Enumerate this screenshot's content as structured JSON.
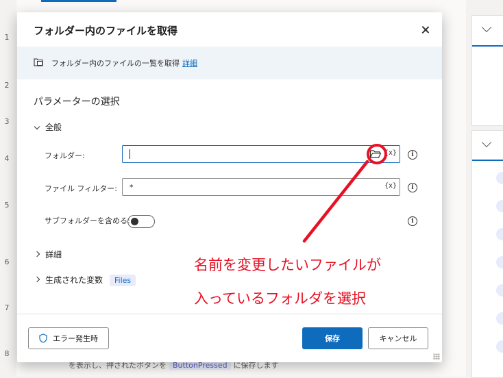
{
  "background": {
    "line_numbers": [
      "1",
      "2",
      "3",
      "4",
      "5",
      "6",
      "7",
      "8"
    ],
    "step8": {
      "prefix": "を表示し、押されたボタンを",
      "chip": "ButtonPressed",
      "suffix": "に保存します"
    }
  },
  "dialog": {
    "title": "フォルダー内のファイルを取得",
    "info": {
      "text": "フォルダー内のファイルの一覧を取得",
      "link": "詳細"
    },
    "section_title": "パラメーターの選択",
    "group_general": "全般",
    "fields": {
      "folder": {
        "label": "フォルダー:",
        "value": "",
        "var_label": "{x}"
      },
      "file_filter": {
        "label": "ファイル フィルター:",
        "value": "*",
        "var_label": "{x}"
      },
      "include_subfolders": {
        "label": "サブフォルダーを含める:",
        "value": false
      }
    },
    "advanced": "詳細",
    "generated_variables": {
      "label": "生成された変数",
      "chip": "Files"
    },
    "buttons": {
      "on_error": "エラー発生時",
      "save": "保存",
      "cancel": "キャンセル"
    }
  },
  "annotation": {
    "line1": "名前を変更したいファイルが",
    "line2": "入っているフォルダを選択",
    "color": "#e81123"
  },
  "colors": {
    "accent": "#0f6cbd",
    "info_band": "#eff4f9"
  }
}
